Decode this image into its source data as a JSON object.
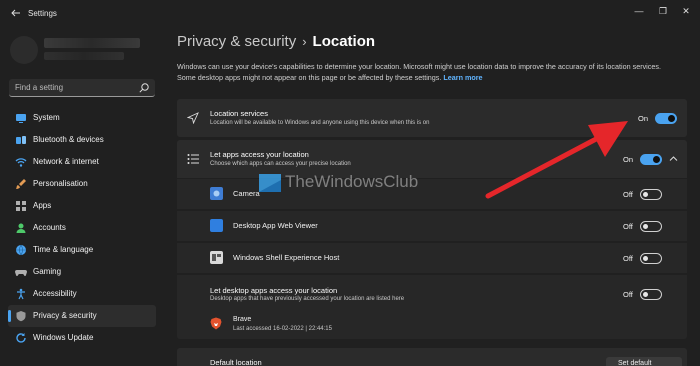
{
  "window": {
    "app_title": "Settings",
    "minimize_glyph": "—",
    "maximize_glyph": "❐",
    "close_glyph": "✕"
  },
  "search": {
    "placeholder": "Find a setting"
  },
  "sidebar": {
    "items": [
      {
        "label": "System",
        "icon": "monitor-icon",
        "color": "#4aa3f0"
      },
      {
        "label": "Bluetooth & devices",
        "icon": "bluetooth-icon",
        "color": "#4aa3f0"
      },
      {
        "label": "Network & internet",
        "icon": "wifi-icon",
        "color": "#4aa3f0"
      },
      {
        "label": "Personalisation",
        "icon": "brush-icon",
        "color": "#e39b54"
      },
      {
        "label": "Apps",
        "icon": "apps-icon",
        "color": "#b0b0b0"
      },
      {
        "label": "Accounts",
        "icon": "person-icon",
        "color": "#4ec96a"
      },
      {
        "label": "Time & language",
        "icon": "globe-icon",
        "color": "#4aa3f0"
      },
      {
        "label": "Gaming",
        "icon": "controller-icon",
        "color": "#b0b0b0"
      },
      {
        "label": "Accessibility",
        "icon": "accessibility-icon",
        "color": "#4aa3f0"
      },
      {
        "label": "Privacy & security",
        "icon": "shield-icon",
        "color": "#9a9a9a",
        "active": true
      },
      {
        "label": "Windows Update",
        "icon": "update-icon",
        "color": "#4aa3f0"
      }
    ]
  },
  "breadcrumb": {
    "parent": "Privacy & security",
    "separator": "›",
    "current": "Location"
  },
  "description": {
    "text": "Windows can use your device's capabilities to determine your location. Microsoft might use location data to improve the accuracy of its location services. Some desktop apps might not appear on this page or be affected by these settings.",
    "link": "Learn more"
  },
  "location_services": {
    "title": "Location services",
    "subtitle": "Location will be available to Windows and anyone using this device when this is on",
    "state": "On"
  },
  "let_apps": {
    "title": "Let apps access your location",
    "subtitle": "Choose which apps can access your precise location",
    "state": "On"
  },
  "apps": [
    {
      "name": "Camera",
      "state": "Off"
    },
    {
      "name": "Desktop App Web Viewer",
      "state": "Off"
    },
    {
      "name": "Windows Shell Experience Host",
      "state": "Off"
    }
  ],
  "desktop_apps": {
    "title": "Let desktop apps access your location",
    "subtitle": "Desktop apps that have previously accessed your location are listed here",
    "state": "Off",
    "entry": {
      "name": "Brave",
      "last_accessed": "Last accessed 16-02-2022  |  22:44:15"
    }
  },
  "default_location": {
    "title": "Default location",
    "button": "Set default"
  },
  "watermark": {
    "text": "TheWindowsClub"
  },
  "colors": {
    "accent": "#4aa3f0",
    "annotation_arrow": "#e5262a"
  }
}
